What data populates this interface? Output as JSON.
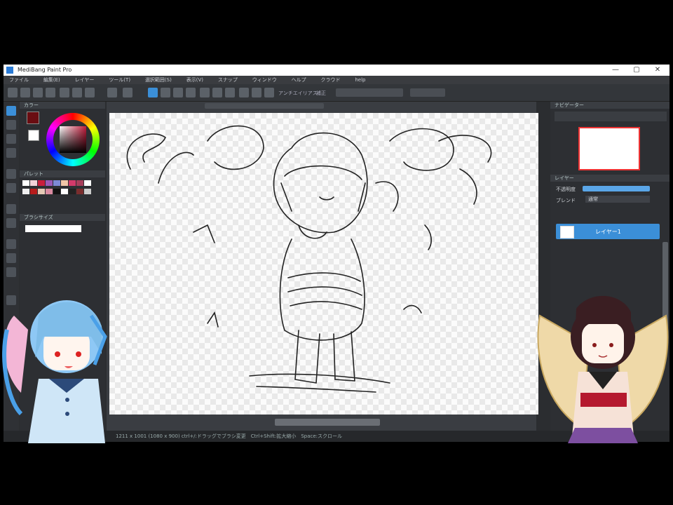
{
  "window": {
    "title": "MediBang Paint Pro",
    "minimize": "—",
    "maximize": "▢",
    "close": "✕"
  },
  "menu": [
    "ファイル",
    "編集(E)",
    "レイヤー",
    "ツール(T)",
    "選択範囲(S)",
    "表示(V)",
    "スナップ",
    "ウィンドウ",
    "ヘルプ",
    "クラウド",
    "help"
  ],
  "panels": {
    "color": "カラー",
    "palette": "パレット",
    "brush_size": "ブラシサイズ",
    "navigator": "ナビゲーター",
    "layer": "レイヤー",
    "opacity_label": "不透明度",
    "blend_label": "ブレンド",
    "blend_value": "通常",
    "layer_name": "レイヤー1"
  },
  "toolbar": {
    "antialias": "アンチエイリアス",
    "zoom": "補正"
  },
  "status": {
    "text": "1211 x 1001 (1080 x 900) ctrl+/:ドラッグでブラシ変更　Ctrl+Shift:拡大縮小　Space:スクロール"
  },
  "colors": {
    "accent": "#3b8fd8",
    "foreground": "#6a0d12",
    "background": "#ffffff"
  }
}
